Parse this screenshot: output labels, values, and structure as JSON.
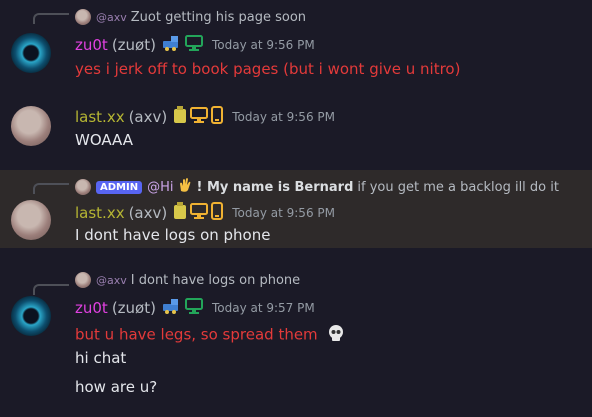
{
  "messages": [
    {
      "reply": {
        "tag": "@axv",
        "text": "Zuot getting his page soon"
      },
      "author": "zu0t",
      "author_tag": "(zuøt)",
      "time": "Today at 9:56 PM",
      "lines": [
        "yes i jerk off to book pages (but i wont give u nitro)"
      ]
    },
    {
      "author": "last.xx",
      "author_tag": "(axv)",
      "time": "Today at 9:56 PM",
      "lines": [
        "WOAAA"
      ]
    },
    {
      "reply": {
        "badge": "ADMIN",
        "mention": "@Hi",
        "bold": "! My name is Bernard",
        "text": "if you get me a backlog ill do it"
      },
      "author": "last.xx",
      "author_tag": "(axv)",
      "time": "Today at 9:56 PM",
      "lines": [
        "I dont have logs on phone"
      ]
    },
    {
      "reply": {
        "tag": "@axv",
        "text": "I dont have logs on phone"
      },
      "author": "zu0t",
      "author_tag": "(zuøt)",
      "time": "Today at 9:57 PM",
      "lines": [
        "but u have legs, so spread them",
        "hi chat",
        "how are u?"
      ]
    }
  ],
  "colors": {
    "background": "#1b1a27",
    "highlight": "#2e2a2a",
    "zuot_name": "#e040e0",
    "last_name": "#b5b533",
    "red_text": "#e33a3a",
    "admin_badge": "#5865f2"
  },
  "icons": [
    "train-icon",
    "desktop-icon",
    "mobile-icon",
    "nitro-badge-icon",
    "wave-emoji",
    "skull-emoji"
  ]
}
